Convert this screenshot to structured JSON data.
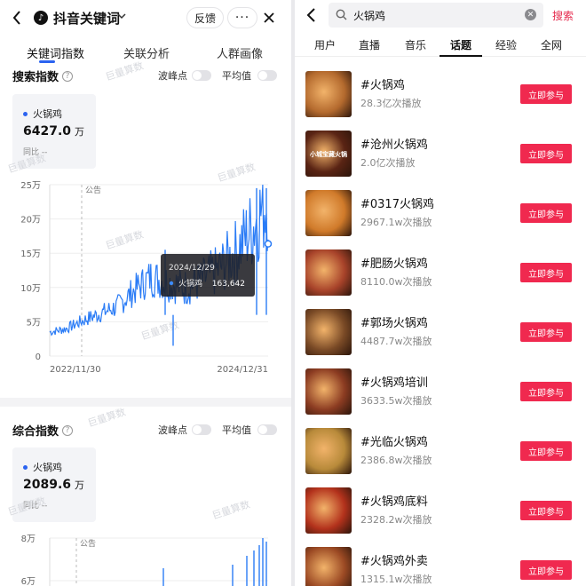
{
  "left": {
    "title": "抖音关键词",
    "feedback": "反馈",
    "more": "···",
    "tabs": [
      "关键词指数",
      "关联分析",
      "人群画像"
    ],
    "watermark": "巨量算数",
    "search_index": {
      "title": "搜索指数",
      "help": "?",
      "toggle_peak": "波峰点",
      "toggle_avg": "平均值",
      "legend_name": "火锅鸡",
      "value": "6427.0",
      "unit": "万",
      "compare": "同比 --"
    },
    "composite_index": {
      "title": "综合指数",
      "help": "?",
      "toggle_peak": "波峰点",
      "toggle_avg": "平均值",
      "legend_name": "火锅鸡",
      "value": "2089.6",
      "unit": "万",
      "compare": "同比 --"
    }
  },
  "chart_data": [
    {
      "type": "line",
      "series": [
        {
          "name": "火锅鸡"
        }
      ],
      "y_ticks": [
        "0",
        "5万",
        "10万",
        "15万",
        "20万",
        "25万"
      ],
      "ylim": [
        0,
        250000
      ],
      "x_labels": [
        "2022/11/30",
        "2024/12/31"
      ],
      "annotation": "公告",
      "tooltip": {
        "date": "2024/12/29",
        "series": "火锅鸡",
        "value": "163,642"
      },
      "x": [
        "2022-11",
        "2023-01",
        "2023-03",
        "2023-05",
        "2023-07",
        "2023-09",
        "2023-11",
        "2024-01",
        "2024-03",
        "2024-05",
        "2024-07",
        "2024-09",
        "2024-11",
        "2024-12"
      ],
      "values": [
        35000,
        40000,
        52000,
        62000,
        72000,
        95000,
        115000,
        108000,
        100000,
        110000,
        125000,
        150000,
        185000,
        230000
      ],
      "color": "#2b7cf6"
    },
    {
      "type": "line",
      "series": [
        {
          "name": "火锅鸡"
        }
      ],
      "y_ticks": [
        "8万",
        "6万"
      ],
      "annotation": "公告",
      "color": "#2b7cf6"
    }
  ],
  "right": {
    "query": "火锅鸡",
    "search_btn": "搜索",
    "tabs": [
      "用户",
      "直播",
      "音乐",
      "话题",
      "经验",
      "全网"
    ],
    "join_label": "立即参与",
    "topics": [
      {
        "name": "#火锅鸡",
        "plays": "28.3亿次播放",
        "thumb": "#b46a2e",
        "thumb_text": ""
      },
      {
        "name": "#沧州火锅鸡",
        "plays": "2.0亿次播放",
        "thumb": "#5a2414",
        "thumb_text": "小城宝藏火锅"
      },
      {
        "name": "#0317火锅鸡",
        "plays": "2967.1w次播放",
        "thumb": "#d07a2a",
        "thumb_text": ""
      },
      {
        "name": "#肥肠火锅鸡",
        "plays": "8110.0w次播放",
        "thumb": "#a8432a",
        "thumb_text": ""
      },
      {
        "name": "#郭场火锅鸡",
        "plays": "4487.7w次播放",
        "thumb": "#7a4a26",
        "thumb_text": ""
      },
      {
        "name": "#火锅鸡培训",
        "plays": "3633.5w次播放",
        "thumb": "#8c3c22",
        "thumb_text": ""
      },
      {
        "name": "#光临火锅鸡",
        "plays": "2386.8w次播放",
        "thumb": "#b88a3a",
        "thumb_text": ""
      },
      {
        "name": "#火锅鸡底料",
        "plays": "2328.2w次播放",
        "thumb": "#b3321c",
        "thumb_text": ""
      },
      {
        "name": "#火锅鸡外卖",
        "plays": "1315.1w次播放",
        "thumb": "#9c4a24",
        "thumb_text": ""
      }
    ]
  }
}
